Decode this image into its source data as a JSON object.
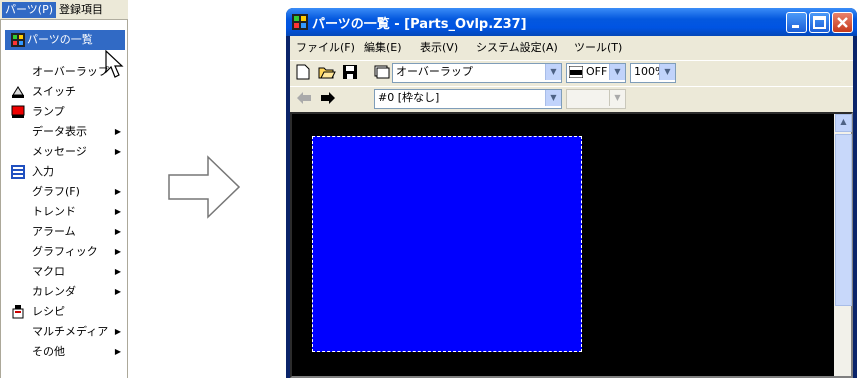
{
  "menu": {
    "menubar": [
      "パーツ(P)",
      "登録項目"
    ],
    "items": [
      {
        "label": "パーツの一覧",
        "icon": "parts-list-icon",
        "selected": true
      },
      {
        "label": "オーバーラップ"
      },
      {
        "label": "スイッチ",
        "icon": "switch-icon"
      },
      {
        "label": "ランプ",
        "icon": "lamp-icon"
      },
      {
        "label": "データ表示",
        "submenu": true
      },
      {
        "label": "メッセージ",
        "submenu": true
      },
      {
        "label": "入力",
        "icon": "input-icon"
      },
      {
        "label": "グラフ(F)",
        "submenu": true
      },
      {
        "label": "トレンド",
        "submenu": true
      },
      {
        "label": "アラーム",
        "submenu": true
      },
      {
        "label": "グラフィック",
        "submenu": true
      },
      {
        "label": "マクロ",
        "submenu": true
      },
      {
        "label": "カレンダ",
        "submenu": true
      },
      {
        "label": "レシピ",
        "icon": "recipe-icon"
      },
      {
        "label": "マルチメディア",
        "submenu": true
      },
      {
        "label": "その他",
        "submenu": true
      }
    ]
  },
  "window": {
    "title": "パーツの一覧 - [Parts_Ovlp.Z37]",
    "menu": [
      "ファイル(F)",
      "編集(E)",
      "表示(V)",
      "システム設定(A)",
      "ツール(T)"
    ],
    "toolbar": {
      "type_combo": "オーバーラップ",
      "off_combo": "OFF",
      "zoom_combo": "100%"
    },
    "toolbar2": {
      "frame_combo": "#0 [枠なし]"
    }
  },
  "colors": {
    "menu_highlight": "#316ac5",
    "canvas_bg": "#000000",
    "part_fill": "#0000ff"
  }
}
